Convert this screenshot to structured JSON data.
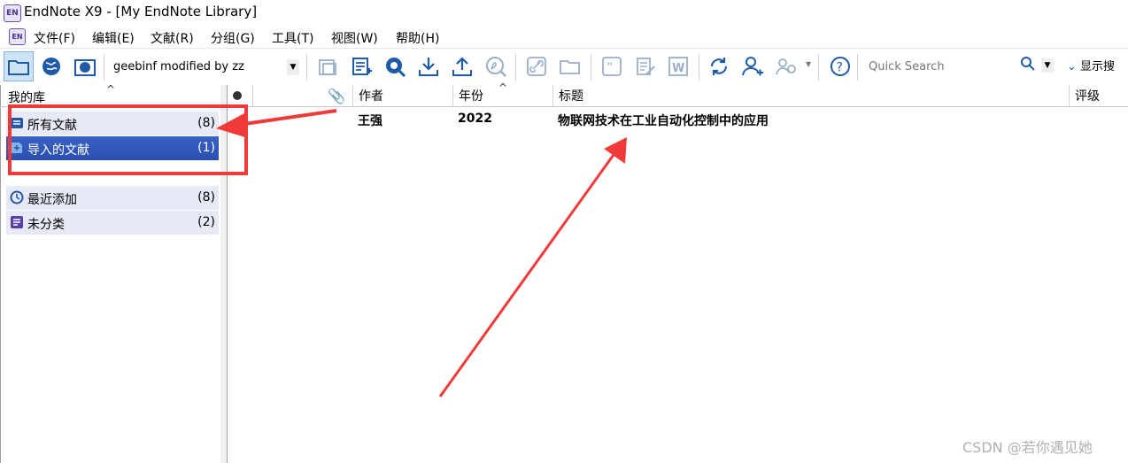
{
  "window": {
    "title": "EndNote X9 - [My EndNote Library]",
    "logo": "EN"
  },
  "menu": {
    "logo": "EN",
    "items": [
      "文件(F)",
      "编辑(E)",
      "文献(R)",
      "分组(G)",
      "工具(T)",
      "视图(W)",
      "帮助(H)"
    ]
  },
  "toolbar": {
    "style_select": "geebinf modified by zz",
    "quick_search_placeholder": "Quick Search",
    "show_search_label": "显示搜"
  },
  "left_pane": {
    "header": "我的库",
    "groups": [
      {
        "label": "所有文献",
        "count": "(8)",
        "icon": "library-icon",
        "selected": false
      },
      {
        "label": "导入的文献",
        "count": "(1)",
        "icon": "import-icon",
        "selected": true
      },
      {
        "label": "最近添加",
        "count": "(8)",
        "icon": "clock-icon",
        "selected": false
      },
      {
        "label": "未分类",
        "count": "(2)",
        "icon": "unfiled-icon",
        "selected": false
      }
    ]
  },
  "table": {
    "columns": {
      "author": "作者",
      "year": "年份",
      "title": "标题",
      "rating": "评级"
    },
    "rows": [
      {
        "author": "王强",
        "year": "2022",
        "title": "物联网技术在工业自动化控制中的应用"
      }
    ]
  },
  "watermark": "CSDN @若你遇见她",
  "colors": {
    "selection": "#2f55b8",
    "group_bg": "#e7e9f6",
    "annotation": "#f03a3a"
  }
}
